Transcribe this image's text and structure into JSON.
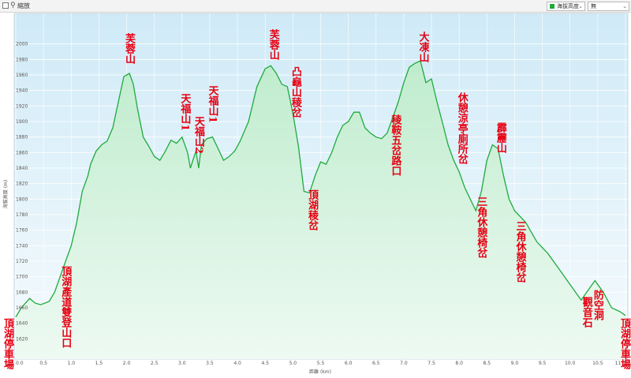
{
  "toolbar": {
    "zoom_label": "縮放",
    "series_select": "海拔高度",
    "extra_select": "無",
    "series_color": "#1faa3c"
  },
  "chart_data": {
    "type": "area",
    "xlabel": "距離 (km)",
    "ylabel": "海拔高度 (m)",
    "xlim": [
      0,
      11
    ],
    "ylim": [
      1600,
      2020
    ],
    "xticks": [
      "0.0",
      "0.5",
      "1.0",
      "1.5",
      "2.0",
      "2.5",
      "3.0",
      "3.5",
      "4.0",
      "4.5",
      "5.0",
      "5.5",
      "6.0",
      "6.5",
      "7.0",
      "7.5",
      "8.0",
      "8.5",
      "9.0",
      "9.5",
      "10.0",
      "10.5",
      "11.0"
    ],
    "yticks": [
      "1620",
      "1640",
      "1660",
      "1680",
      "1700",
      "1720",
      "1740",
      "1760",
      "1780",
      "1800",
      "1820",
      "1840",
      "1860",
      "1880",
      "1900",
      "1920",
      "1940",
      "1960",
      "1980",
      "2000"
    ],
    "line_color": "#1faa3c",
    "x": [
      0,
      0.1,
      0.25,
      0.35,
      0.45,
      0.6,
      0.7,
      0.8,
      0.9,
      1.0,
      1.1,
      1.2,
      1.3,
      1.35,
      1.45,
      1.55,
      1.65,
      1.75,
      1.85,
      1.95,
      2.05,
      2.12,
      2.2,
      2.3,
      2.4,
      2.5,
      2.6,
      2.7,
      2.8,
      2.9,
      3.0,
      3.1,
      3.15,
      3.25,
      3.3,
      3.35,
      3.45,
      3.55,
      3.65,
      3.75,
      3.85,
      3.95,
      4.05,
      4.2,
      4.35,
      4.5,
      4.6,
      4.7,
      4.8,
      4.9,
      5.0,
      5.1,
      5.2,
      5.3,
      5.4,
      5.5,
      5.6,
      5.7,
      5.8,
      5.9,
      6.0,
      6.1,
      6.2,
      6.3,
      6.4,
      6.5,
      6.6,
      6.7,
      6.8,
      6.9,
      7.0,
      7.1,
      7.2,
      7.3,
      7.4,
      7.5,
      7.6,
      7.7,
      7.8,
      7.9,
      8.0,
      8.1,
      8.2,
      8.3,
      8.4,
      8.5,
      8.6,
      8.7,
      8.8,
      8.9,
      9.0,
      9.2,
      9.4,
      9.6,
      9.8,
      10.0,
      10.2,
      10.35,
      10.45,
      10.6,
      10.75,
      10.9,
      11.0
    ],
    "y": [
      1648,
      1660,
      1672,
      1666,
      1664,
      1668,
      1680,
      1700,
      1720,
      1740,
      1770,
      1810,
      1830,
      1845,
      1862,
      1870,
      1875,
      1892,
      1925,
      1958,
      1962,
      1948,
      1915,
      1880,
      1868,
      1855,
      1850,
      1862,
      1876,
      1872,
      1880,
      1860,
      1840,
      1862,
      1840,
      1870,
      1878,
      1880,
      1865,
      1850,
      1855,
      1862,
      1875,
      1900,
      1945,
      1968,
      1972,
      1962,
      1948,
      1945,
      1910,
      1868,
      1810,
      1808,
      1830,
      1848,
      1845,
      1860,
      1880,
      1895,
      1900,
      1912,
      1912,
      1892,
      1885,
      1880,
      1878,
      1885,
      1905,
      1925,
      1950,
      1970,
      1975,
      1978,
      1950,
      1955,
      1925,
      1898,
      1870,
      1850,
      1835,
      1815,
      1800,
      1785,
      1810,
      1850,
      1870,
      1865,
      1830,
      1800,
      1785,
      1770,
      1745,
      1730,
      1710,
      1690,
      1670,
      1685,
      1695,
      1680,
      1660,
      1655,
      1650
    ],
    "annotations": [
      {
        "text": "頂湖停車場",
        "x": 0.0
      },
      {
        "text": "頂湖產道雙登山口",
        "x": 0.9
      },
      {
        "text": "芙蓉山",
        "x": 2.05
      },
      {
        "text": "天福山1",
        "x": 3.05
      },
      {
        "text": "天福山2",
        "x": 3.3
      },
      {
        "text": "天福山1",
        "x": 3.55
      },
      {
        "text": "芙蓉山",
        "x": 4.65
      },
      {
        "text": "凸龜山稜岔",
        "x": 5.05
      },
      {
        "text": "頂湖稜岔",
        "x": 5.35
      },
      {
        "text": "稜鞍五岔路口",
        "x": 6.85
      },
      {
        "text": "大凍山",
        "x": 7.35
      },
      {
        "text": "休憩涼亭廁所岔",
        "x": 8.05
      },
      {
        "text": "三角休憩椅岔",
        "x": 8.4
      },
      {
        "text": "霹靂山",
        "x": 8.75
      },
      {
        "text": "三角休憩椅岔",
        "x": 9.1
      },
      {
        "text": "觀音石",
        "x": 10.3
      },
      {
        "text": "防空洞",
        "x": 10.5
      },
      {
        "text": "頂湖停車場",
        "x": 11.0
      }
    ]
  }
}
